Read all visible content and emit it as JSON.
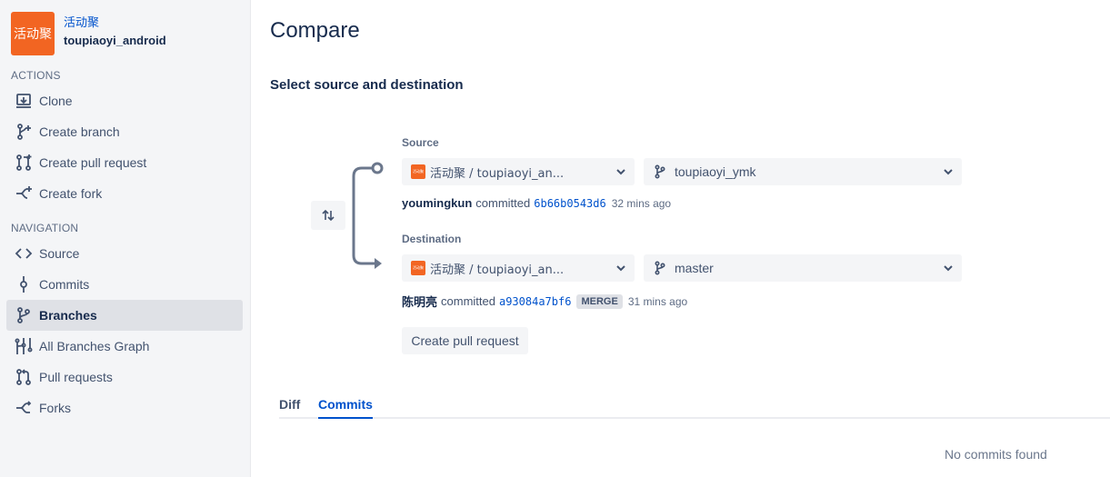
{
  "repo": {
    "avatar_text": "活动聚",
    "project": "活动聚",
    "name": "toupiaoyi_android"
  },
  "sidebar": {
    "actions_label": "ACTIONS",
    "actions": [
      {
        "label": "Clone",
        "icon": "clone-icon"
      },
      {
        "label": "Create branch",
        "icon": "branch-icon"
      },
      {
        "label": "Create pull request",
        "icon": "pull-request-icon"
      },
      {
        "label": "Create fork",
        "icon": "fork-icon"
      }
    ],
    "navigation_label": "NAVIGATION",
    "navigation": [
      {
        "label": "Source",
        "icon": "code-icon"
      },
      {
        "label": "Commits",
        "icon": "commit-icon"
      },
      {
        "label": "Branches",
        "icon": "branch-icon",
        "active": true
      },
      {
        "label": "All Branches Graph",
        "icon": "graph-icon"
      },
      {
        "label": "Pull requests",
        "icon": "pull-request-icon"
      },
      {
        "label": "Forks",
        "icon": "fork-icon"
      }
    ]
  },
  "page": {
    "title": "Compare",
    "subtitle": "Select source and destination"
  },
  "source": {
    "label": "Source",
    "repo_select": "活动聚 / toupiaoyi_an...",
    "branch_select": "toupiaoyi_ymk",
    "commit": {
      "author": "youmingkun",
      "verb": "committed",
      "hash": "6b66b0543d6",
      "time": "32 mins ago"
    }
  },
  "destination": {
    "label": "Destination",
    "repo_select": "活动聚 / toupiaoyi_an...",
    "branch_select": "master",
    "commit": {
      "author": "陈明亮",
      "verb": "committed",
      "hash": "a93084a7bf6",
      "badge": "MERGE",
      "time": "31 mins ago"
    }
  },
  "actions": {
    "create_pr": "Create pull request"
  },
  "tabs": [
    {
      "label": "Diff"
    },
    {
      "label": "Commits",
      "active": true
    }
  ],
  "empty_message": "No commits found",
  "colors": {
    "brand": "#f26522",
    "link": "#0052cc",
    "sidebar_bg": "#f4f5f7"
  }
}
